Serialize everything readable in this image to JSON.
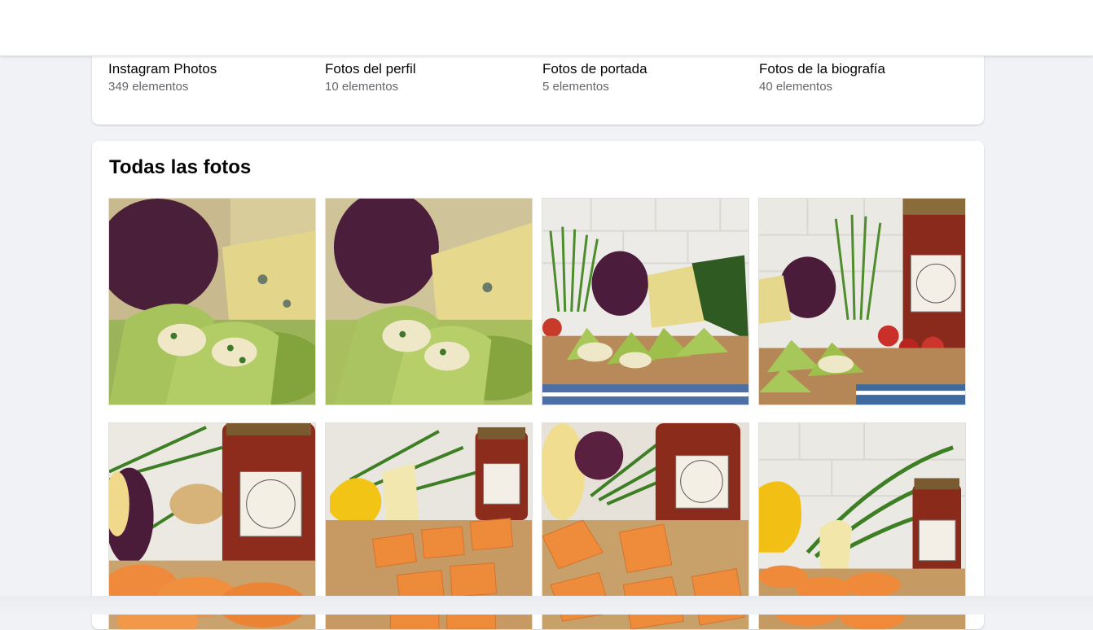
{
  "albums": [
    {
      "title": "Instagram Photos",
      "count": "349 elementos"
    },
    {
      "title": "Fotos del perfil",
      "count": "10 elementos"
    },
    {
      "title": "Fotos de portada",
      "count": "5 elementos"
    },
    {
      "title": "Fotos de la biografía",
      "count": "40 elementos"
    }
  ],
  "photos_section": {
    "title": "Todas las fotos"
  },
  "colors": {
    "page_bg": "#f0f2f5",
    "card_bg": "#ffffff",
    "title_text": "#050505",
    "secondary_text": "#65676b"
  }
}
